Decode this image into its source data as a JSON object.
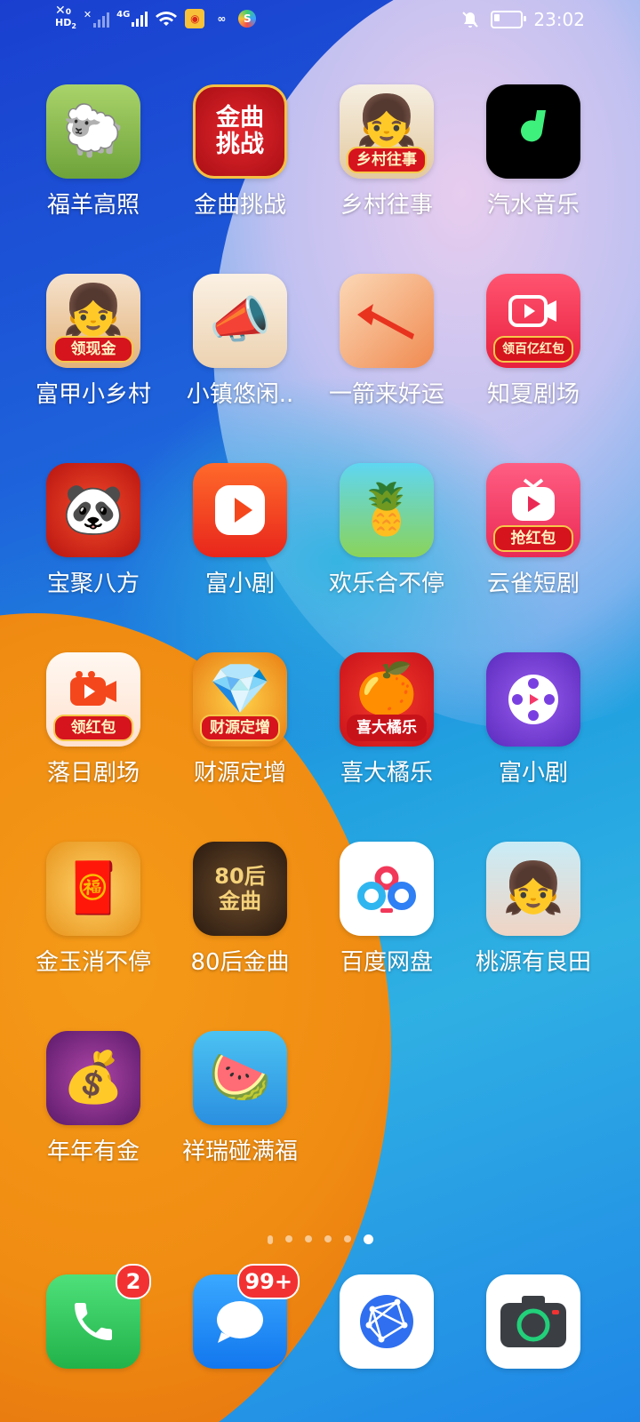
{
  "status_bar": {
    "hd_label": "HD",
    "hd_sub": "2",
    "net1": "0",
    "net2": "4G",
    "time": "23:02",
    "icons": [
      "sim-off-icon",
      "signal-icon",
      "signal-4g-icon",
      "wifi-icon",
      "weibo-icon",
      "app-icon",
      "app-icon",
      "mute-icon",
      "battery-icon"
    ]
  },
  "apps": [
    {
      "label": "福羊高照",
      "icon": "sheep-icon",
      "color": "#8fbf4a",
      "banner": ""
    },
    {
      "label": "金曲挑战",
      "icon": "music-challenge-icon",
      "color": "#c8161d",
      "banner": "",
      "text": "金曲挑战"
    },
    {
      "label": "乡村往事",
      "icon": "village-girl-icon",
      "color": "#e8d7b8",
      "banner": "乡村往事"
    },
    {
      "label": "汽水音乐",
      "icon": "soda-music-icon",
      "color": "#000000",
      "banner": ""
    },
    {
      "label": "富甲小乡村",
      "icon": "girl-icon",
      "color": "#f0c89a",
      "banner": "领现金"
    },
    {
      "label": "小镇悠闲..",
      "icon": "megaphone-girl-icon",
      "color": "#f3e3cf",
      "banner": ""
    },
    {
      "label": "一箭来好运",
      "icon": "arrow-icon",
      "color": "#f2a36a",
      "banner": ""
    },
    {
      "label": "知夏剧场",
      "icon": "video-icon",
      "color": "#f33a55",
      "banner": "领百亿红包"
    },
    {
      "label": "宝聚八方",
      "icon": "panda-icon",
      "color": "#d8261c",
      "banner": ""
    },
    {
      "label": "富小剧",
      "icon": "play-icon",
      "color": "#f4471c",
      "banner": ""
    },
    {
      "label": "欢乐合不停",
      "icon": "pineapple-icon",
      "color": "#39c6e8",
      "banner": ""
    },
    {
      "label": "云雀短剧",
      "icon": "tv-icon",
      "color": "#f5486c",
      "banner": "抢红包"
    },
    {
      "label": "落日剧场",
      "icon": "camera-icon",
      "color": "#fff2ea",
      "banner": "领红包"
    },
    {
      "label": "财源定增",
      "icon": "gem-icon",
      "color": "#f3a01d",
      "banner": "财源定增"
    },
    {
      "label": "喜大橘乐",
      "icon": "orange-icon",
      "color": "#e3261e",
      "banner": "喜大橘乐"
    },
    {
      "label": "富小剧",
      "icon": "film-reel-icon",
      "color": "#6c3fd6",
      "banner": ""
    },
    {
      "label": "金玉消不停",
      "icon": "fortune-god-icon",
      "color": "#f2b23a",
      "banner": ""
    },
    {
      "label": "80后金曲",
      "icon": "retro-tv-icon",
      "color": "#3a2a1e",
      "banner": "",
      "text": "80后\n金曲"
    },
    {
      "label": "百度网盘",
      "icon": "baidu-cloud-icon",
      "color": "#ffffff",
      "banner": ""
    },
    {
      "label": "桃源有良田",
      "icon": "girl-hanfu-icon",
      "color": "#b9e2f2",
      "banner": ""
    },
    {
      "label": "年年有金",
      "icon": "treasure-chest-icon",
      "color": "#7a2a86",
      "banner": ""
    },
    {
      "label": "祥瑞碰满福",
      "icon": "fruit-icon",
      "color": "#2ea8e8",
      "banner": ""
    }
  ],
  "dock": [
    {
      "icon": "phone-icon",
      "badge": "2",
      "color": "#35c95b"
    },
    {
      "icon": "messages-icon",
      "badge": "99+",
      "color": "#1e8ff5"
    },
    {
      "icon": "browser-icon",
      "badge": "",
      "color": "#ffffff"
    },
    {
      "icon": "camera-app-icon",
      "badge": "",
      "color": "#ffffff"
    }
  ],
  "page_indicator": {
    "count": 6,
    "active": 6
  }
}
